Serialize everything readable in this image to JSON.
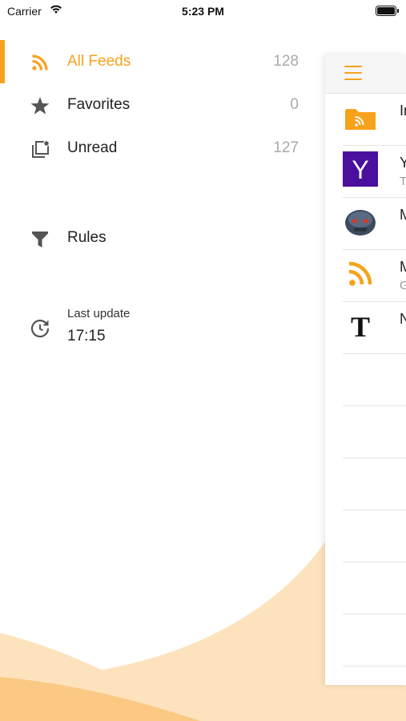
{
  "status_bar": {
    "carrier": "Carrier",
    "time": "5:23 PM"
  },
  "menu": {
    "items": [
      {
        "label": "All Feeds",
        "count": "128",
        "icon": "rss-icon"
      },
      {
        "label": "Favorites",
        "count": "0",
        "icon": "star-icon"
      },
      {
        "label": "Unread",
        "count": "127",
        "icon": "unread-icon"
      },
      {
        "label": "Rules",
        "icon": "filter-icon"
      }
    ],
    "last_update": {
      "label": "Last update",
      "time": "17:15",
      "icon": "clock-refresh-icon"
    }
  },
  "feed_list": {
    "rows": [
      {
        "title": "In",
        "subtitle": "",
        "icon": "folder-rss-icon"
      },
      {
        "title": "Y",
        "subtitle": "T",
        "icon": "yahoo-logo-icon"
      },
      {
        "title": "M",
        "subtitle": "",
        "icon": "mascot-avatar-icon"
      },
      {
        "title": "M",
        "subtitle": "G",
        "icon": "rss-icon"
      },
      {
        "title": "N",
        "subtitle": "",
        "icon": "nyt-logo-icon"
      },
      {
        "title": "",
        "subtitle": ""
      },
      {
        "title": "",
        "subtitle": ""
      },
      {
        "title": "",
        "subtitle": ""
      },
      {
        "title": "",
        "subtitle": ""
      },
      {
        "title": "",
        "subtitle": ""
      },
      {
        "title": "",
        "subtitle": ""
      }
    ]
  },
  "colors": {
    "accent": "#f7a21b",
    "icon_gray": "#555555",
    "count_gray": "#aaaaaa",
    "wave_light": "#fde3bd",
    "wave_dark": "#fbc984"
  }
}
